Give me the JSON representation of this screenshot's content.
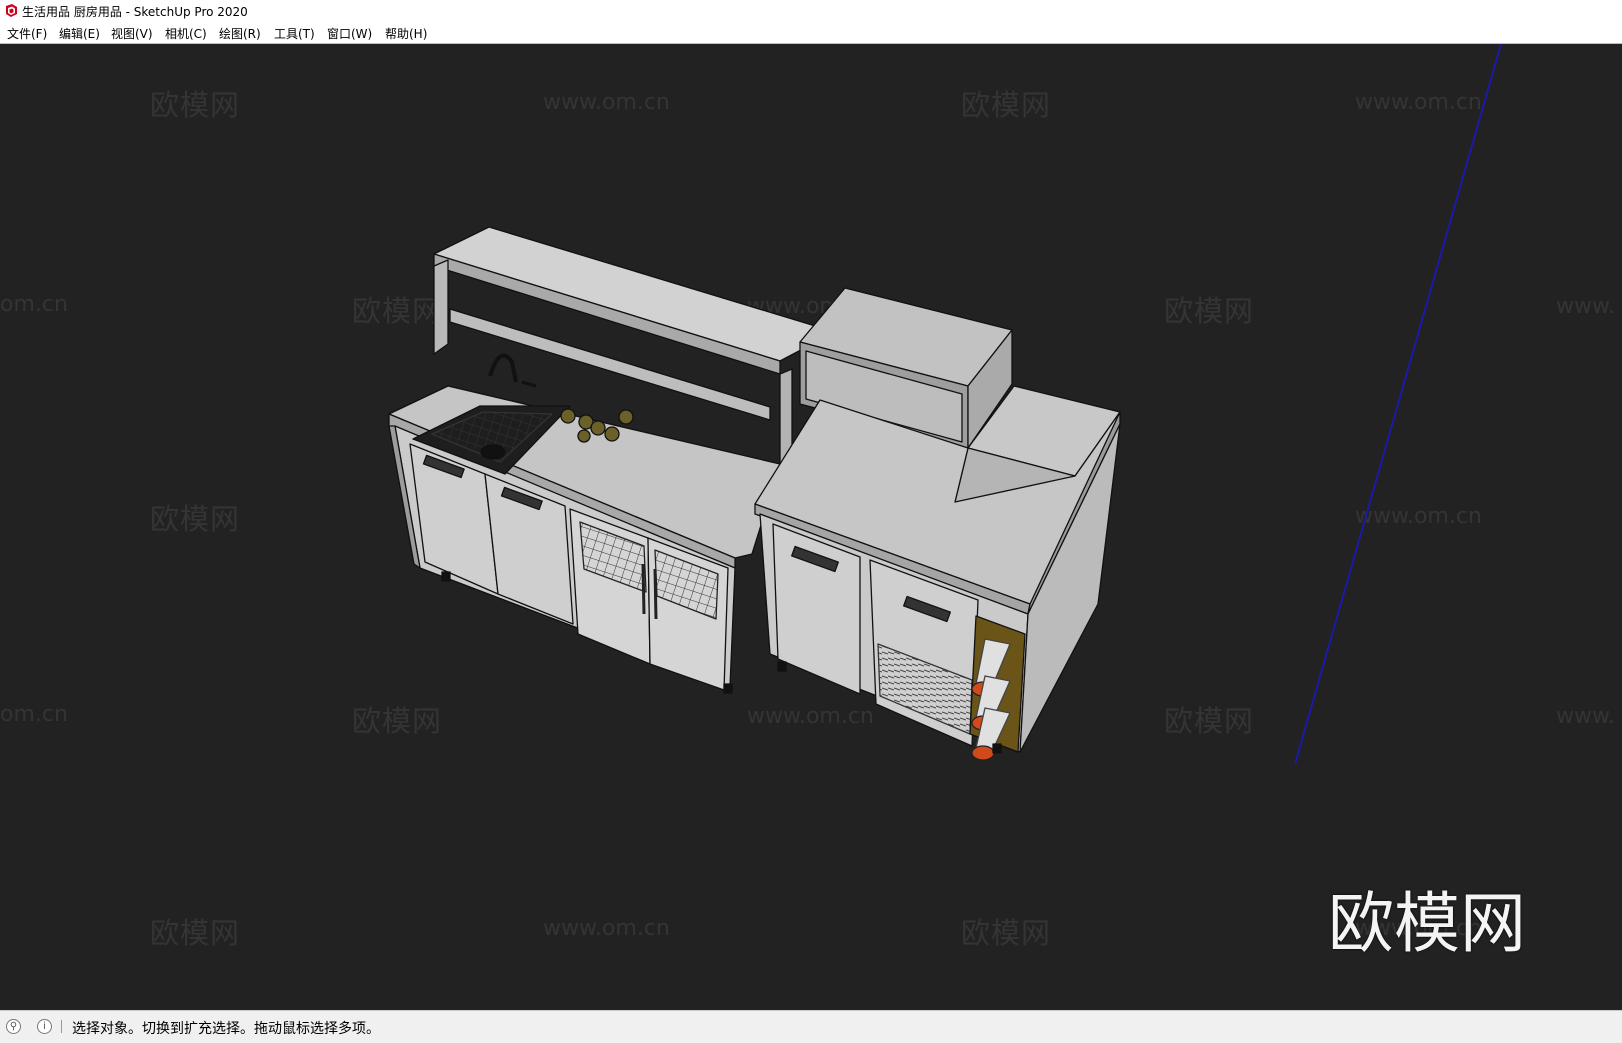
{
  "window": {
    "title": "生活用品 厨房用品 - SketchUp Pro 2020",
    "app_icon": "sketchup-logo-icon"
  },
  "menu": [
    {
      "label": "文件(F)"
    },
    {
      "label": "编辑(E)"
    },
    {
      "label": "视图(V)"
    },
    {
      "label": "相机(C)"
    },
    {
      "label": "绘图(R)"
    },
    {
      "label": "工具(T)"
    },
    {
      "label": "窗口(W)"
    },
    {
      "label": "帮助(H)"
    }
  ],
  "viewport": {
    "background_color": "#222222",
    "model_face_color": "#c8c8c8",
    "axis_color": "#1a1aa8",
    "watermark_site": "www.om.cn",
    "watermark_brand": "欧模网",
    "watermark_partial": "om.cn",
    "watermark_edge": "www.",
    "logo_watermark": "欧模网"
  },
  "status": {
    "text": "选择对象。切换到扩充选择。拖动鼠标选择多项。",
    "icons": [
      "geo-location-icon",
      "info-icon"
    ]
  }
}
